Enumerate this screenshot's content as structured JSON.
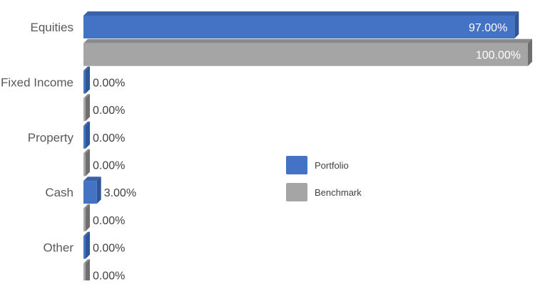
{
  "chart_data": {
    "type": "bar",
    "orientation": "horizontal",
    "style": "3d",
    "categories": [
      "Equities",
      "Fixed Income",
      "Property",
      "Cash",
      "Other"
    ],
    "series": [
      {
        "name": "Portfolio",
        "color": "#4472C4",
        "values": [
          97.0,
          0.0,
          0.0,
          3.0,
          0.0
        ],
        "value_labels": [
          "97.00%",
          "0.00%",
          "0.00%",
          "3.00%",
          "0.00%"
        ]
      },
      {
        "name": "Benchmark",
        "color": "#A5A5A5",
        "values": [
          100.0,
          0.0,
          0.0,
          0.0,
          0.0
        ],
        "value_labels": [
          "100.00%",
          "0.00%",
          "0.00%",
          "0.00%",
          "0.00%"
        ]
      }
    ],
    "xlim": [
      0,
      100
    ],
    "title": "",
    "xlabel": "",
    "ylabel": "",
    "grid": false,
    "legend_position": "right"
  }
}
